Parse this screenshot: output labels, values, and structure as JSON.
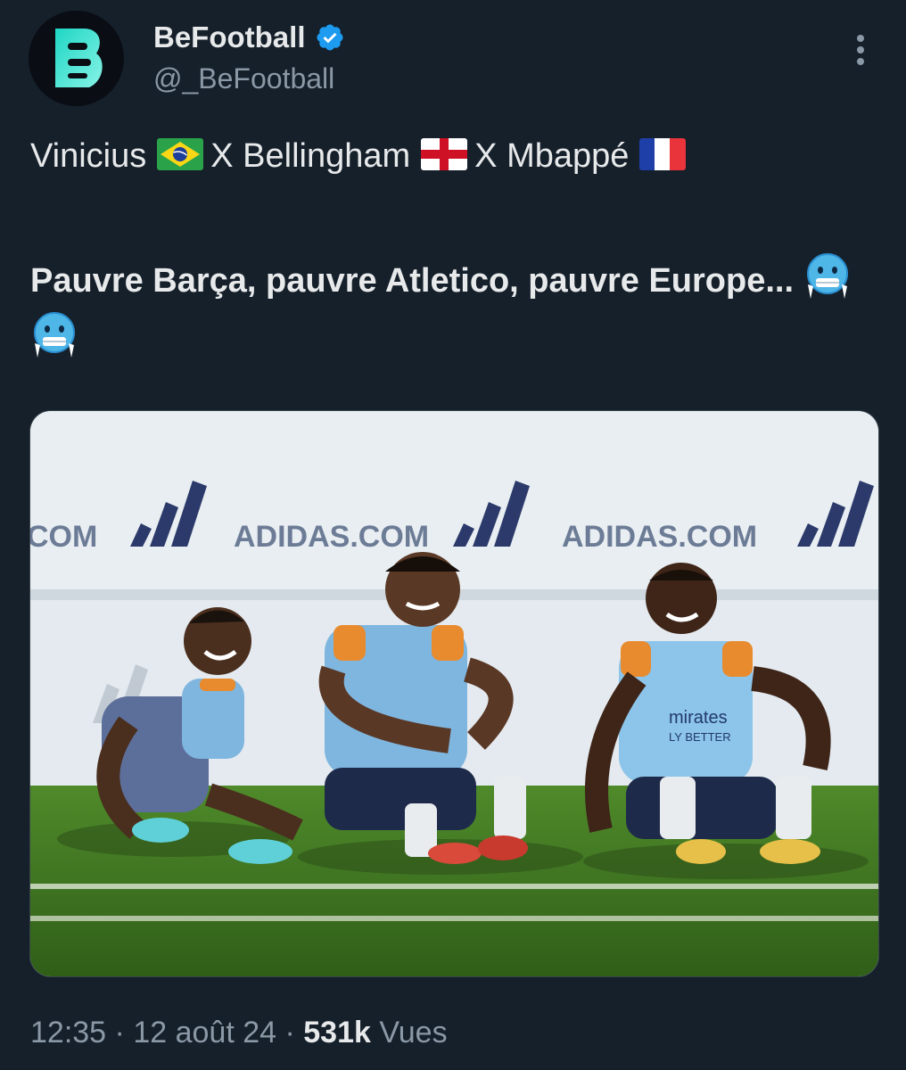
{
  "author": {
    "display_name": "BeFootball",
    "handle": "@_BeFootball",
    "verified": true,
    "avatar_icon": "befootball-logo-icon",
    "brand_colors": {
      "logo_gradient_start": "#1fd6c4",
      "logo_gradient_end": "#7ef0e2",
      "avatar_bg": "#0a0e14"
    }
  },
  "menu": {
    "icon": "more-vertical-icon"
  },
  "tweet": {
    "line1": {
      "player1": "Vinicius",
      "flag1": "brazil-flag-icon",
      "sep1": "X Bellingham",
      "flag2": "england-flag-icon",
      "sep2": "X Mbappé",
      "flag3": "france-flag-icon"
    },
    "bold_text": "Pauvre Barça, pauvre Atletico, pauvre Europe...",
    "emoji": [
      "cold-face-emoji",
      "cold-face-emoji"
    ]
  },
  "media": {
    "type": "photo",
    "banner_text": "ADIDAS.COM",
    "jersey_text": "mirates",
    "jersey_subtext": "LY BETTER"
  },
  "meta": {
    "time": "12:35",
    "date": "12 août 24",
    "separator": "·",
    "views_count": "531k",
    "views_label": "Vues"
  },
  "colors": {
    "background": "#15202b",
    "text_primary": "#e7e9ea",
    "text_secondary": "#8b98a5",
    "verified": "#1d9bf0"
  }
}
